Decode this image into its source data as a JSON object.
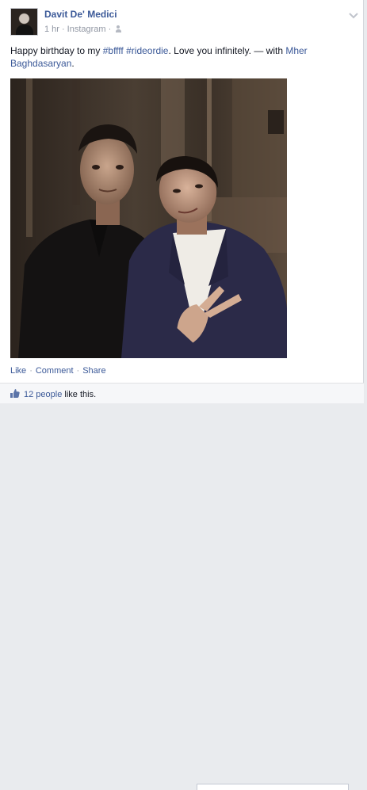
{
  "post": {
    "author": "Davit De' Medici",
    "time": "1 hr",
    "separator": "·",
    "source": "Instagram",
    "text": {
      "prefix": "Happy birthday to my ",
      "hashtag_1": "#bffff",
      "space": " ",
      "hashtag_2": "#rideordie",
      "middle": ". Love you infinitely. — with ",
      "tagged": "Mher Baghdasaryan",
      "suffix": "."
    },
    "icons": {
      "avatar": "profile-photo",
      "audience": "friends-icon",
      "menu": "chevron-down-icon",
      "like": "thumbs-up-icon"
    }
  },
  "actions": {
    "like": "Like",
    "comment": "Comment",
    "share": "Share",
    "dot": "·"
  },
  "likes": {
    "count": "12 people",
    "suffix": " like this."
  },
  "colors": {
    "link": "#3b5998",
    "meta": "#9197a3",
    "text": "#141823"
  }
}
